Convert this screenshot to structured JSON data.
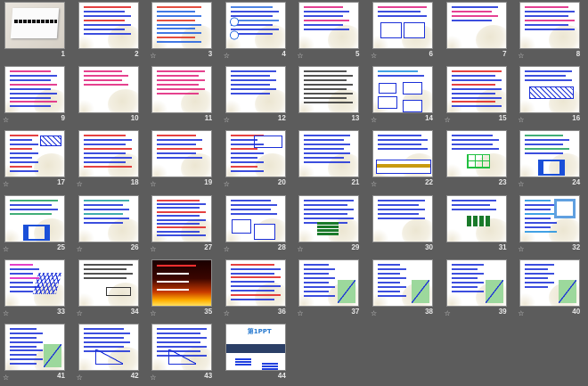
{
  "view": "slide-sorter",
  "slides": [
    {
      "number": "1",
      "star": false,
      "kind": "title"
    },
    {
      "number": "2",
      "star": false,
      "kind": "text",
      "color": "#1a2fd8",
      "accent": "#e02020",
      "lines": 7
    },
    {
      "number": "3",
      "star": true,
      "kind": "text",
      "color": "#2060e0",
      "accent": "#e03020",
      "lines": 9
    },
    {
      "number": "4",
      "star": true,
      "kind": "text",
      "color": "#1a2fd8",
      "accent": "#3070e0",
      "lines": 7,
      "fig": "circles"
    },
    {
      "number": "5",
      "star": true,
      "kind": "text",
      "color": "#1a2fd8",
      "accent": "#e02080",
      "lines": 6
    },
    {
      "number": "6",
      "star": true,
      "kind": "text",
      "color": "#1a2fd8",
      "accent": "#e02080",
      "lines": 3,
      "fig": "rect"
    },
    {
      "number": "7",
      "star": false,
      "kind": "text",
      "color": "#e02080",
      "accent": "#1a2fd8",
      "lines": 4
    },
    {
      "number": "8",
      "star": true,
      "kind": "text",
      "color": "#1a2fd8",
      "accent": "#e02080",
      "lines": 6
    },
    {
      "number": "9",
      "star": true,
      "kind": "text",
      "color": "#1a2fd8",
      "accent": "#e02080",
      "lines": 9
    },
    {
      "number": "10",
      "star": false,
      "kind": "text",
      "color": "#e0207a",
      "accent": "#e0207a",
      "lines": 4
    },
    {
      "number": "11",
      "star": false,
      "kind": "text",
      "color": "#e0207a",
      "accent": "#e0207a",
      "lines": 6
    },
    {
      "number": "12",
      "star": true,
      "kind": "text",
      "color": "#1a2fd8",
      "accent": "#1a2fd8",
      "lines": 6
    },
    {
      "number": "13",
      "star": false,
      "kind": "text",
      "color": "#333333",
      "accent": "#333333",
      "lines": 8
    },
    {
      "number": "14",
      "star": true,
      "kind": "text",
      "color": "#1a2fd8",
      "accent": "#2090e0",
      "lines": 2,
      "fig": "rects"
    },
    {
      "number": "15",
      "star": true,
      "kind": "text",
      "color": "#1a2fd8",
      "accent": "#e02020",
      "lines": 9
    },
    {
      "number": "16",
      "star": true,
      "kind": "text",
      "color": "#1a2fd8",
      "accent": "#1a2fd8",
      "lines": 3,
      "fig": "hatch"
    },
    {
      "number": "17",
      "star": true,
      "kind": "text",
      "color": "#1a2fd8",
      "accent": "#e02020",
      "lines": 9,
      "fig": "hatch-small"
    },
    {
      "number": "18",
      "star": true,
      "kind": "text",
      "color": "#1a2fd8",
      "accent": "#e02020",
      "lines": 8
    },
    {
      "number": "19",
      "star": true,
      "kind": "text",
      "color": "#1a2fd8",
      "accent": "#e02020",
      "lines": 6
    },
    {
      "number": "20",
      "star": true,
      "kind": "text",
      "color": "#1a2fd8",
      "accent": "#e02020",
      "lines": 9,
      "fig": "rect-small"
    },
    {
      "number": "21",
      "star": false,
      "kind": "text",
      "color": "#1a2fd8",
      "accent": "#1a2fd8",
      "lines": 7
    },
    {
      "number": "22",
      "star": true,
      "kind": "text",
      "color": "#1a2fd8",
      "accent": "#1a2fd8",
      "lines": 4,
      "fig": "gold"
    },
    {
      "number": "23",
      "star": false,
      "kind": "text",
      "color": "#1a2fd8",
      "accent": "#1a2fd8",
      "lines": 4,
      "fig": "green-grid"
    },
    {
      "number": "24",
      "star": true,
      "kind": "text",
      "color": "#1a2fd8",
      "accent": "#20a060",
      "lines": 5,
      "fig": "blue-frame"
    },
    {
      "number": "25",
      "star": true,
      "kind": "text",
      "color": "#1a2fd8",
      "accent": "#20a060",
      "lines": 4,
      "fig": "blue-frame"
    },
    {
      "number": "26",
      "star": true,
      "kind": "text",
      "color": "#1a2fd8",
      "accent": "#20a0a0",
      "lines": 6
    },
    {
      "number": "27",
      "star": true,
      "kind": "text",
      "color": "#1a2fd8",
      "accent": "#e02020",
      "lines": 10
    },
    {
      "number": "28",
      "star": true,
      "kind": "text",
      "color": "#1a2fd8",
      "accent": "#1a2fd8",
      "lines": 4,
      "fig": "boxes"
    },
    {
      "number": "29",
      "star": true,
      "kind": "text",
      "color": "#1a2fd8",
      "accent": "#1a2fd8",
      "lines": 6,
      "fig": "dark-green"
    },
    {
      "number": "30",
      "star": false,
      "kind": "text",
      "color": "#1a2fd8",
      "accent": "#1a2fd8",
      "lines": 5
    },
    {
      "number": "31",
      "star": false,
      "kind": "text",
      "color": "#1a2fd8",
      "accent": "#1a2fd8",
      "lines": 3,
      "fig": "checker"
    },
    {
      "number": "32",
      "star": true,
      "kind": "text",
      "color": "#1a2fd8",
      "accent": "#2090e0",
      "lines": 8,
      "fig": "square-frame"
    },
    {
      "number": "33",
      "star": true,
      "kind": "text",
      "color": "#1a2fd8",
      "accent": "#e020c0",
      "lines": 7,
      "fig": "lattice"
    },
    {
      "number": "34",
      "star": true,
      "kind": "text",
      "color": "#333333",
      "accent": "#333333",
      "lines": 4,
      "fig": "ruler"
    },
    {
      "number": "35",
      "star": true,
      "kind": "fire"
    },
    {
      "number": "36",
      "star": true,
      "kind": "text",
      "color": "#1a2fd8",
      "accent": "#e02020",
      "lines": 9
    },
    {
      "number": "37",
      "star": true,
      "kind": "text",
      "color": "#1a2fd8",
      "accent": "#1a2fd8",
      "lines": 8,
      "fig": "green-tri"
    },
    {
      "number": "38",
      "star": true,
      "kind": "text",
      "color": "#1a2fd8",
      "accent": "#1a2fd8",
      "lines": 8,
      "fig": "green-tri"
    },
    {
      "number": "39",
      "star": true,
      "kind": "text",
      "color": "#1a2fd8",
      "accent": "#1a2fd8",
      "lines": 7,
      "fig": "green-tri"
    },
    {
      "number": "40",
      "star": true,
      "kind": "text",
      "color": "#1a2fd8",
      "accent": "#1a2fd8",
      "lines": 6,
      "fig": "green-tri"
    },
    {
      "number": "41",
      "star": true,
      "kind": "text",
      "color": "#1a2fd8",
      "accent": "#1a2fd8",
      "lines": 9,
      "fig": "green-tri"
    },
    {
      "number": "42",
      "star": true,
      "kind": "text",
      "color": "#1a2fd8",
      "accent": "#1a2fd8",
      "lines": 6,
      "fig": "triangle"
    },
    {
      "number": "43",
      "star": true,
      "kind": "text",
      "color": "#1a2fd8",
      "accent": "#1a2fd8",
      "lines": 7,
      "fig": "triangle"
    },
    {
      "number": "44",
      "star": false,
      "kind": "logo",
      "logo": "第1PPT"
    }
  ],
  "star_glyph": "☆"
}
